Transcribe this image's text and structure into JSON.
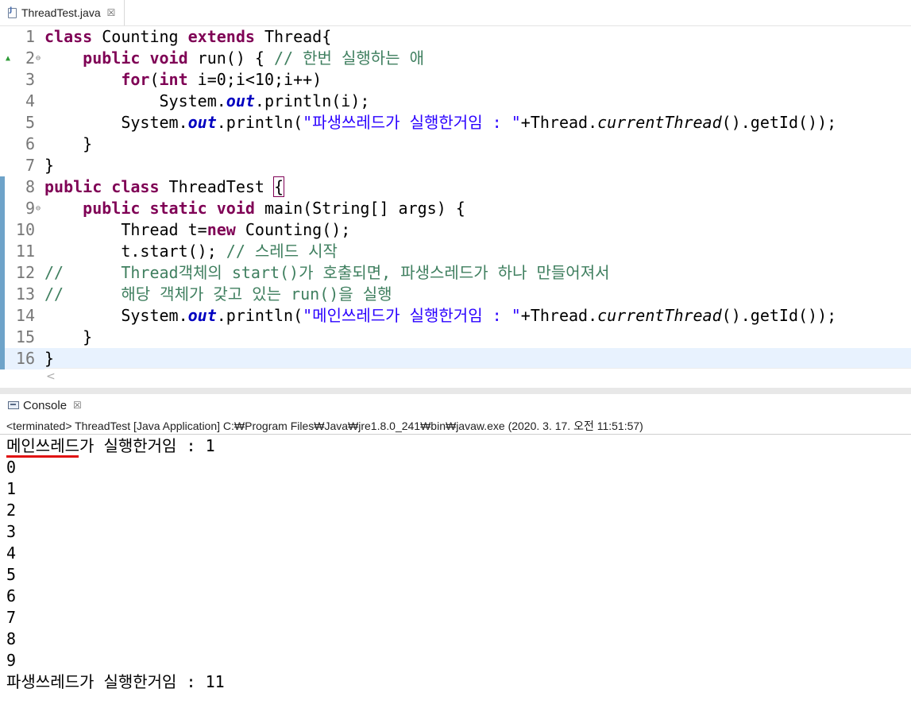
{
  "editor_tab": {
    "filename": "ThreadTest.java",
    "close": "☒"
  },
  "code_lines": [
    {
      "n": "1",
      "code": [
        [
          "kw",
          "class"
        ],
        [
          "",
          " Counting "
        ],
        [
          "kw",
          "extends"
        ],
        [
          "",
          " Thread{"
        ]
      ]
    },
    {
      "n": "2",
      "code": [
        [
          "",
          "    "
        ],
        [
          "kw",
          "public"
        ],
        [
          "",
          " "
        ],
        [
          "kw",
          "void"
        ],
        [
          "",
          " run() { "
        ],
        [
          "cmt",
          "// 한번 실행하는 애"
        ]
      ]
    },
    {
      "n": "3",
      "code": [
        [
          "",
          "        "
        ],
        [
          "kw",
          "for"
        ],
        [
          "",
          "("
        ],
        [
          "kw",
          "int"
        ],
        [
          "",
          " i=0;i<10;i++)"
        ]
      ]
    },
    {
      "n": "4",
      "code": [
        [
          "",
          "            System."
        ],
        [
          "fld",
          "out"
        ],
        [
          "",
          ".println(i);"
        ]
      ]
    },
    {
      "n": "5",
      "code": [
        [
          "",
          "        System."
        ],
        [
          "fld",
          "out"
        ],
        [
          "",
          ".println("
        ],
        [
          "str",
          "\"파생쓰레드가 실행한거임 : \""
        ],
        [
          "",
          "+Thread."
        ],
        [
          "st",
          "currentThread"
        ],
        [
          "",
          "().getId());"
        ]
      ]
    },
    {
      "n": "6",
      "code": [
        [
          "",
          "    }"
        ]
      ]
    },
    {
      "n": "7",
      "code": [
        [
          "",
          "}"
        ]
      ]
    },
    {
      "n": "8",
      "code": [
        [
          "kw",
          "public"
        ],
        [
          "",
          " "
        ],
        [
          "kw",
          "class"
        ],
        [
          "",
          " ThreadTest "
        ],
        [
          "box",
          "{"
        ]
      ]
    },
    {
      "n": "9",
      "code": [
        [
          "",
          "    "
        ],
        [
          "kw",
          "public"
        ],
        [
          "",
          " "
        ],
        [
          "kw",
          "static"
        ],
        [
          "",
          " "
        ],
        [
          "kw",
          "void"
        ],
        [
          "",
          " main(String[] args) {"
        ]
      ]
    },
    {
      "n": "10",
      "code": [
        [
          "",
          "        Thread t="
        ],
        [
          "kw",
          "new"
        ],
        [
          "",
          " Counting();"
        ]
      ]
    },
    {
      "n": "11",
      "code": [
        [
          "",
          "        t.start(); "
        ],
        [
          "cmt",
          "// 스레드 시작"
        ]
      ]
    },
    {
      "n": "12",
      "code": [
        [
          "cmt",
          "//      Thread객체의 start()가 호출되면, 파생스레드가 하나 만들어져서"
        ]
      ]
    },
    {
      "n": "13",
      "code": [
        [
          "cmt",
          "//      해당 객체가 갖고 있는 run()을 실행"
        ]
      ]
    },
    {
      "n": "14",
      "code": [
        [
          "",
          "        System."
        ],
        [
          "fld",
          "out"
        ],
        [
          "",
          ".println("
        ],
        [
          "str",
          "\"메인쓰레드가 실행한거임 : \""
        ],
        [
          "",
          "+Thread."
        ],
        [
          "st",
          "currentThread"
        ],
        [
          "",
          "().getId());"
        ]
      ]
    },
    {
      "n": "15",
      "code": [
        [
          "",
          "    }"
        ]
      ]
    },
    {
      "n": "16",
      "code": [
        [
          "",
          "}"
        ]
      ]
    }
  ],
  "editor_scroll": {
    "left_arrow": "<"
  },
  "console_tab": {
    "label": "Console",
    "close": "☒"
  },
  "console_header": "<terminated> ThreadTest [Java Application] C:₩Program Files₩Java₩jre1.8.0_241₩bin₩javaw.exe (2020. 3. 17. 오전 11:51:57)",
  "console_output": [
    "메인쓰레드가 실행한거임 : 1",
    "0",
    "1",
    "2",
    "3",
    "4",
    "5",
    "6",
    "7",
    "8",
    "9",
    "파생쓰레드가 실행한거임 : 11"
  ],
  "colors": {
    "keyword": "#7f0055",
    "string": "#2a00ff",
    "comment": "#3f7f5f",
    "field": "#0000c0",
    "current_line": "#e8f2fe",
    "gutter_mark": "#6ea3c9",
    "annotation_underline": "#e01010"
  }
}
